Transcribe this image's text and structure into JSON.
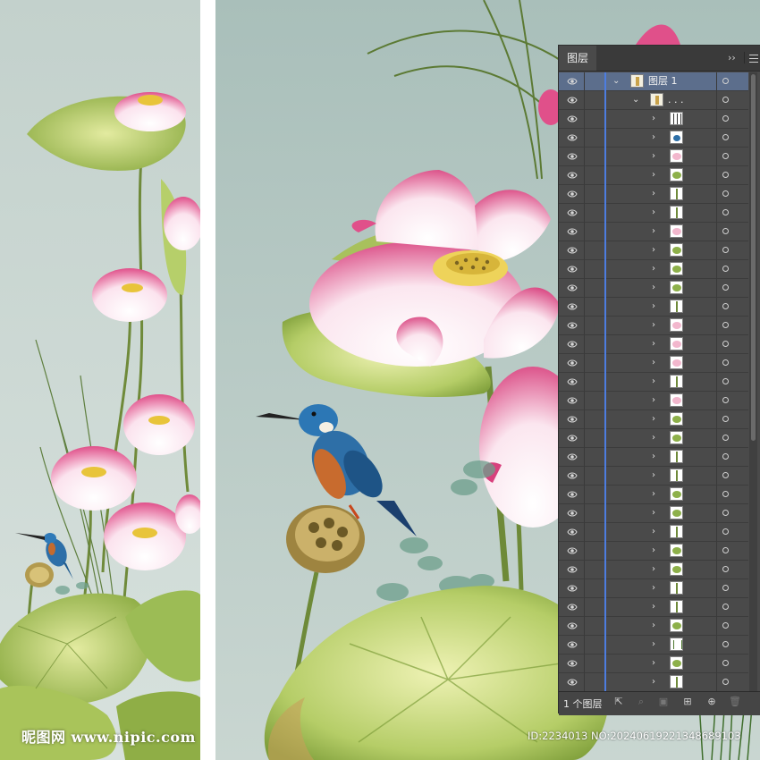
{
  "layers_panel": {
    "tab_label": "图层",
    "collapse_glyph": "››",
    "top_layer_name": "图层 1",
    "group_name": ". . .",
    "footer_count": "1 个图层",
    "rows": [
      {
        "thumb": "lines"
      },
      {
        "thumb": "bird"
      },
      {
        "thumb": "pink"
      },
      {
        "thumb": "leaf"
      },
      {
        "thumb": "stem"
      },
      {
        "thumb": "stem"
      },
      {
        "thumb": "pink"
      },
      {
        "thumb": "leaf"
      },
      {
        "thumb": "leaf"
      },
      {
        "thumb": "leaf"
      },
      {
        "thumb": "stem"
      },
      {
        "thumb": "pink"
      },
      {
        "thumb": "pink"
      },
      {
        "thumb": "pink"
      },
      {
        "thumb": "stem"
      },
      {
        "thumb": "pink"
      },
      {
        "thumb": "leaf"
      },
      {
        "thumb": "leaf"
      },
      {
        "thumb": "stem"
      },
      {
        "thumb": "stem"
      },
      {
        "thumb": "leaf"
      },
      {
        "thumb": "leaf"
      },
      {
        "thumb": "stem"
      },
      {
        "thumb": "leaf"
      },
      {
        "thumb": "leaf"
      },
      {
        "thumb": "stem"
      },
      {
        "thumb": "stem"
      },
      {
        "thumb": "leaf"
      },
      {
        "thumb": "grass"
      },
      {
        "thumb": "leaf"
      },
      {
        "thumb": "stem"
      }
    ]
  },
  "watermark": {
    "site_cn": "昵图网",
    "site_url": "www.nipic.com",
    "id_text": "ID:2234013 NO:20240619221348689103"
  },
  "colors": {
    "background_left": "#c9d6d0",
    "background_right": "#b3c7c2",
    "panel_bg": "#4a4a4a",
    "selected_row": "#5c6e8c",
    "layer_bar": "#4d7de0",
    "lotus_pink": "#e0508a",
    "leaf_green": "#a9c45a"
  }
}
